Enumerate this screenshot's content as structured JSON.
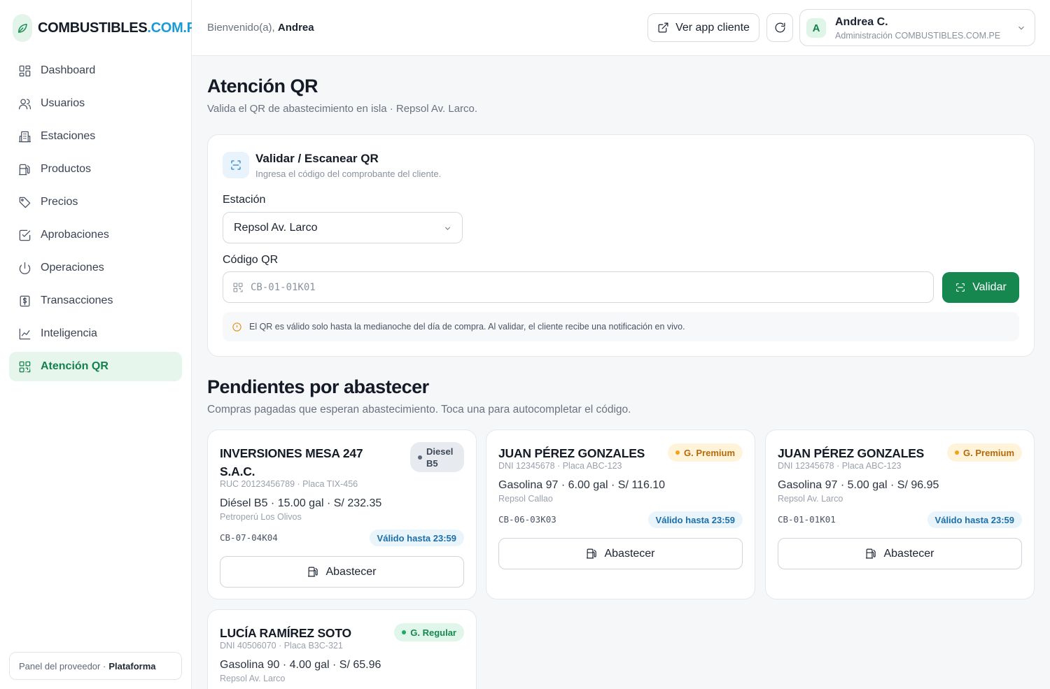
{
  "brand": {
    "name": "COMBUSTIBLES",
    "suffix": ".COM.PE",
    "accent": "#1a9bd6",
    "primary": "#15874f",
    "icon": "leaf-icon"
  },
  "topbar": {
    "welcome_prefix": "Bienvenido(a),",
    "welcome_name": "Andrea",
    "view_client_label": "Ver app cliente",
    "user_initial": "A",
    "user_name": "Andrea C.",
    "user_role": "Administración COMBUSTIBLES.COM.PE"
  },
  "sidebar": {
    "items": [
      {
        "label": "Dashboard",
        "icon": "dashboard-icon",
        "active": false
      },
      {
        "label": "Usuarios",
        "icon": "users-icon",
        "active": false
      },
      {
        "label": "Estaciones",
        "icon": "building-icon",
        "active": false
      },
      {
        "label": "Productos",
        "icon": "fuel-pump-icon",
        "active": false
      },
      {
        "label": "Precios",
        "icon": "tag-icon",
        "active": false
      },
      {
        "label": "Aprobaciones",
        "icon": "checkbox-icon",
        "active": false
      },
      {
        "label": "Operaciones",
        "icon": "power-icon",
        "active": false
      },
      {
        "label": "Transacciones",
        "icon": "receipt-icon",
        "active": false
      },
      {
        "label": "Inteligencia",
        "icon": "chart-line-icon",
        "active": false
      },
      {
        "label": "Atención QR",
        "icon": "qr-code-icon",
        "active": true
      }
    ],
    "footer_prefix": "Panel del proveedor ·",
    "footer_strong": "Plataforma"
  },
  "page": {
    "title": "Atención QR",
    "subtitle": "Valida el QR de abastecimiento en isla · Repsol Av. Larco."
  },
  "validate_card": {
    "title": "Validar / Escanear QR",
    "subtitle": "Ingresa el código del comprobante del cliente.",
    "station_label": "Estación",
    "station_value": "Repsol Av. Larco",
    "qr_label": "Código QR",
    "qr_placeholder": "CB-01-01K01",
    "validate_button": "Validar",
    "notice": "El QR es válido solo hasta la medianoche del día de compra. Al validar, el cliente recibe una notificación en vivo."
  },
  "pending": {
    "title": "Pendientes por abastecer",
    "subtitle": "Compras pagadas que esperan abastecimiento. Toca una para autocompletar el código.",
    "cards": [
      {
        "name": "INVERSIONES MESA 247 S.A.C.",
        "badge": "Diesel B5",
        "badge_kind": "diesel",
        "meta": "RUC 20123456789 · Placa TIX-456",
        "desc": "Diésel B5 · 15.00 gal · S/ 232.35",
        "station": "Petroperú Los Olivos",
        "code": "CB-07-04K04",
        "valid": "Válido hasta 23:59",
        "action": "Abastecer"
      },
      {
        "name": "JUAN PÉREZ GONZALES",
        "badge": "G. Premium",
        "badge_kind": "premium",
        "meta": "DNI 12345678 · Placa ABC-123",
        "desc": "Gasolina 97 · 6.00 gal · S/ 116.10",
        "station": "Repsol Callao",
        "code": "CB-06-03K03",
        "valid": "Válido hasta 23:59",
        "action": "Abastecer"
      },
      {
        "name": "JUAN PÉREZ GONZALES",
        "badge": "G. Premium",
        "badge_kind": "premium",
        "meta": "DNI 12345678 · Placa ABC-123",
        "desc": "Gasolina 97 · 5.00 gal · S/ 96.95",
        "station": "Repsol Av. Larco",
        "code": "CB-01-01K01",
        "valid": "Válido hasta 23:59",
        "action": "Abastecer"
      },
      {
        "name": "LUCÍA RAMÍREZ SOTO",
        "badge": "G. Regular",
        "badge_kind": "regular",
        "meta": "DNI 40506070 · Placa B3C-321",
        "desc": "Gasolina 90 · 4.00 gal · S/ 65.96",
        "station": "Repsol Av. Larco"
      }
    ]
  }
}
